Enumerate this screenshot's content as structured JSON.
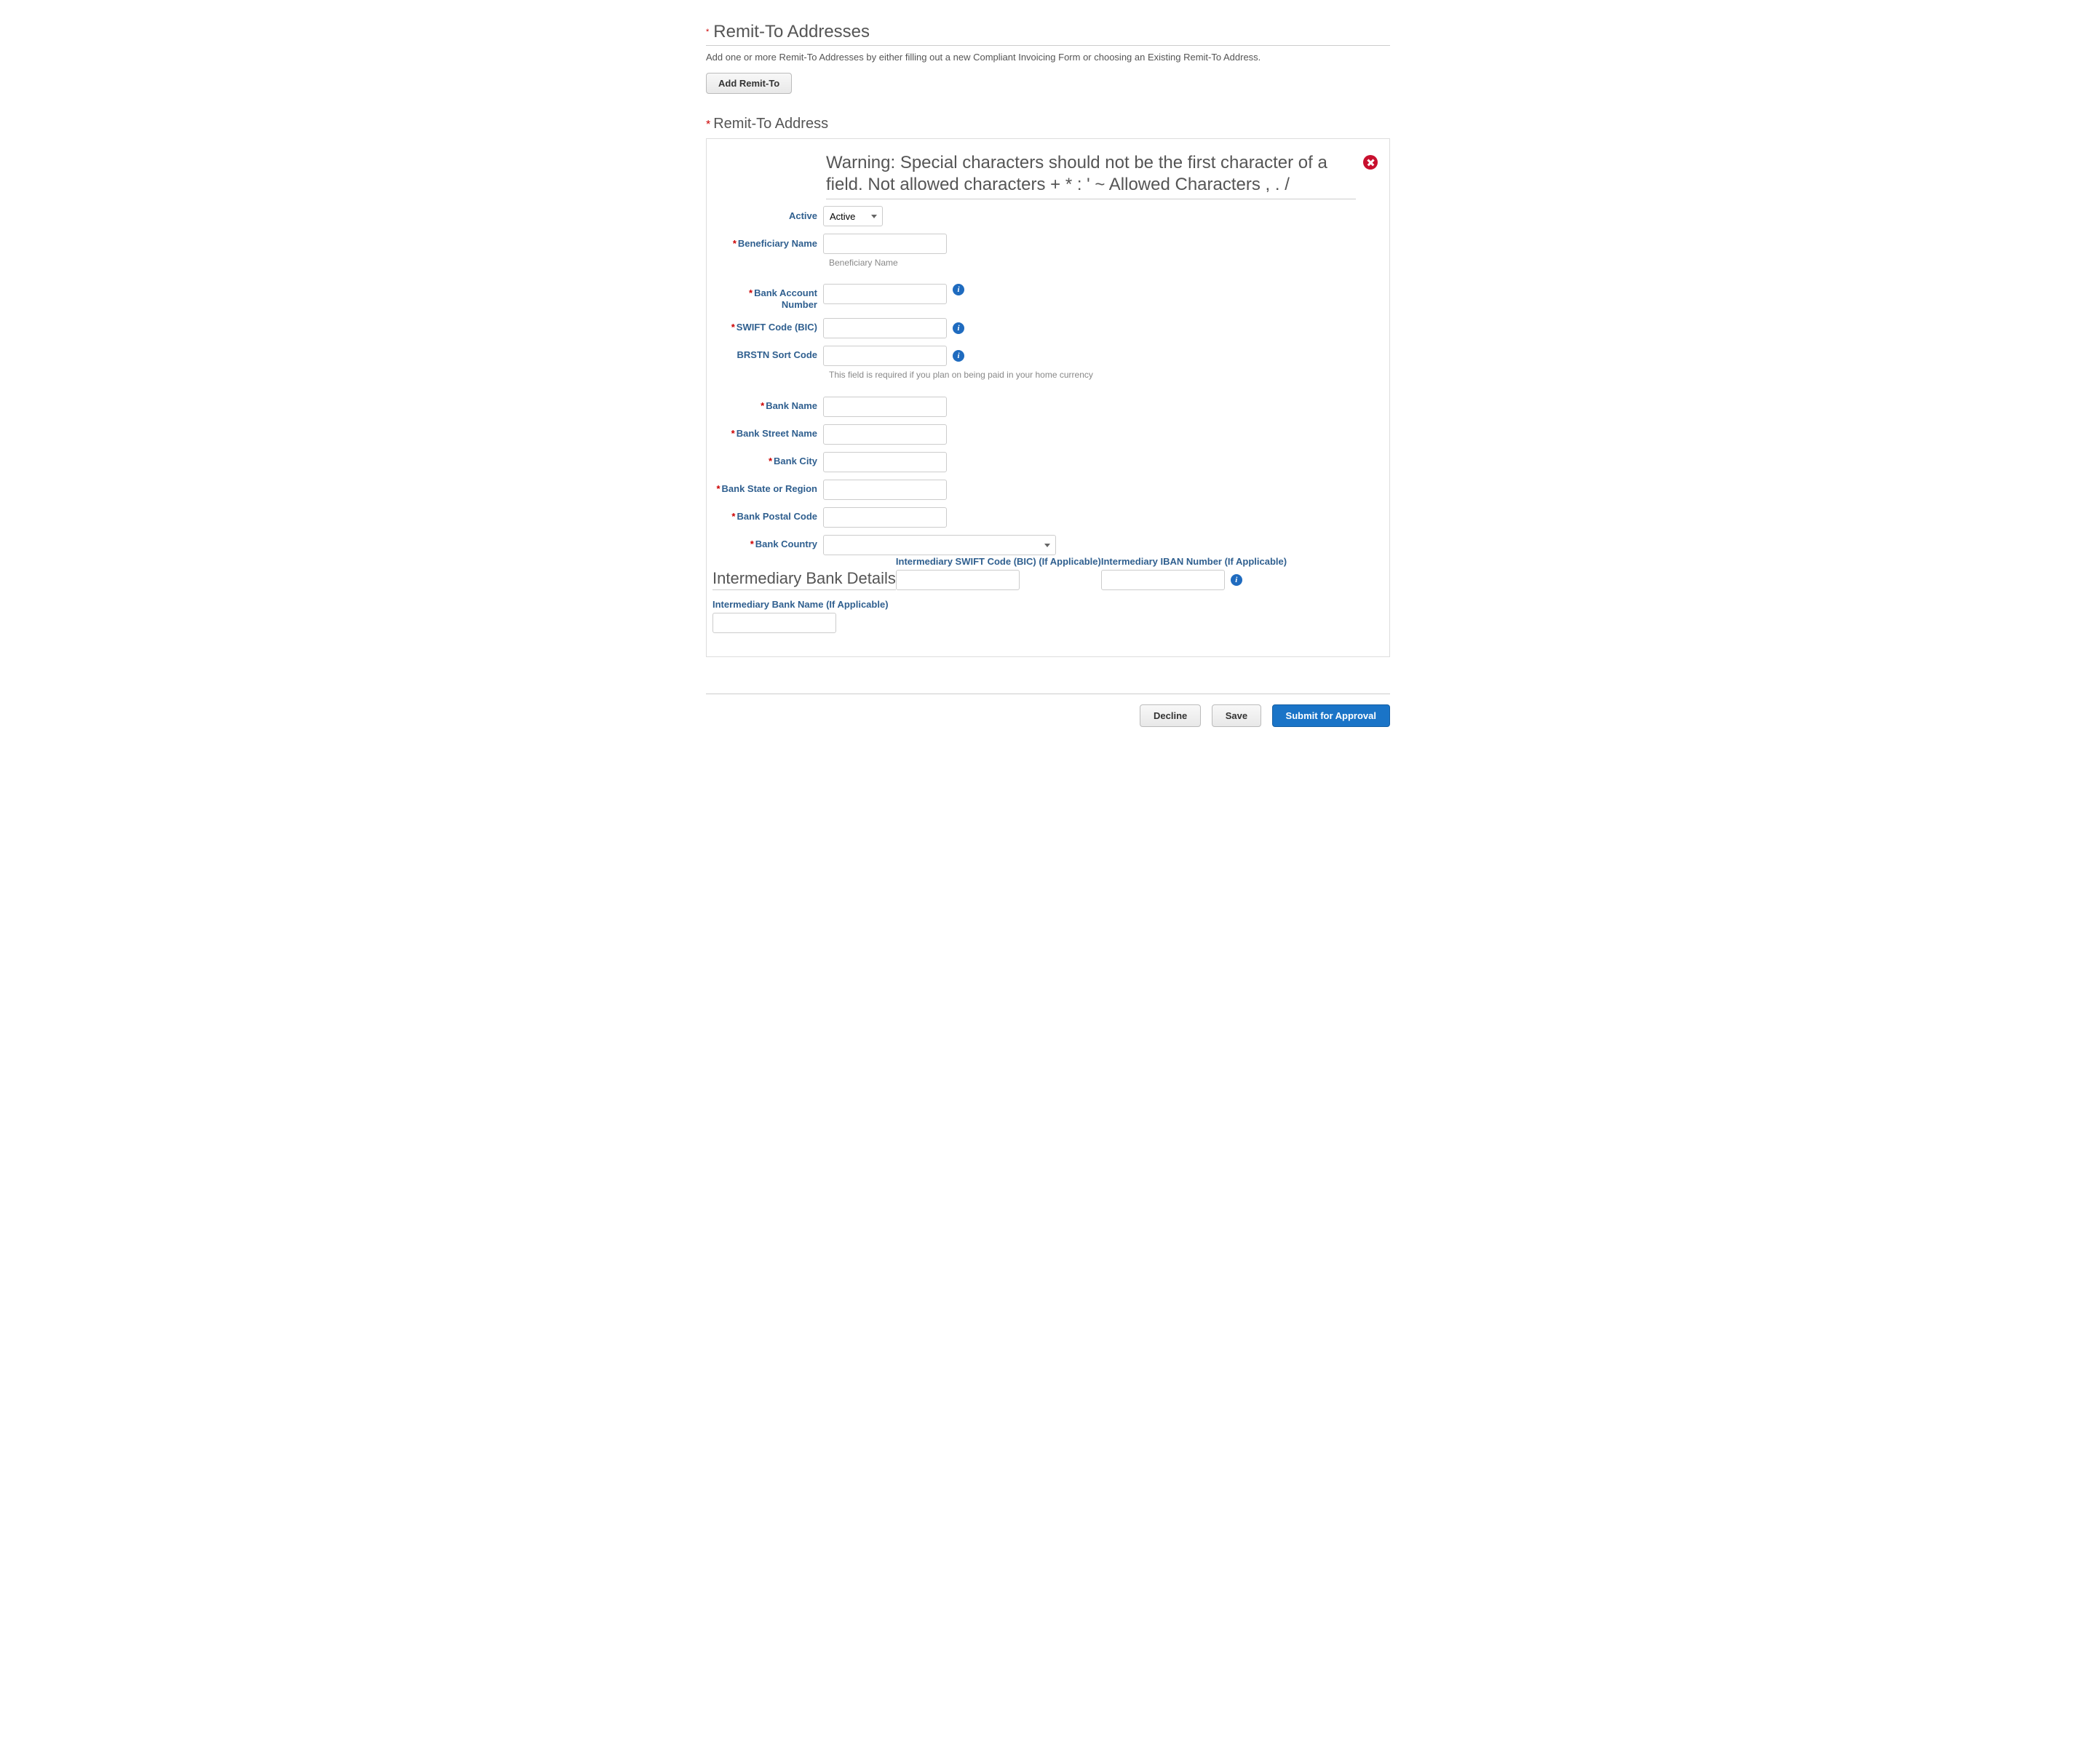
{
  "section": {
    "title": "Remit-To Addresses",
    "help": "Add one or more Remit-To Addresses by either filling out a new Compliant Invoicing Form or choosing an Existing Remit-To Address.",
    "add_button": "Add Remit-To"
  },
  "subsection": {
    "title": "Remit-To Address"
  },
  "panel": {
    "warning": "Warning: Special characters should not be the first character of a field. Not allowed characters + * : ' ~ Allowed Characters , . /",
    "fields": {
      "active": {
        "label": "Active",
        "value": "Active"
      },
      "beneficiary_name": {
        "label": "Beneficiary Name",
        "hint": "Beneficiary Name"
      },
      "bank_account_number": {
        "label": "Bank Account Number"
      },
      "swift_code": {
        "label": "SWIFT Code (BIC)"
      },
      "brstn": {
        "label": "BRSTN Sort Code",
        "hint": "This field is required if you plan on being paid in your home currency"
      },
      "bank_name": {
        "label": "Bank Name"
      },
      "bank_street": {
        "label": "Bank Street Name"
      },
      "bank_city": {
        "label": "Bank City"
      },
      "bank_state": {
        "label": "Bank State or Region"
      },
      "bank_postal": {
        "label": "Bank Postal Code"
      },
      "bank_country": {
        "label": "Bank Country"
      }
    },
    "intermediary": {
      "title": "Intermediary Bank Details",
      "swift_label": "Intermediary SWIFT Code (BIC) (If Applicable)",
      "iban_label": "Intermediary IBAN Number (If Applicable)",
      "bank_name_label": "Intermediary Bank Name (If Applicable)"
    },
    "info_char": "i"
  },
  "footer": {
    "decline": "Decline",
    "save": "Save",
    "submit": "Submit for Approval"
  }
}
